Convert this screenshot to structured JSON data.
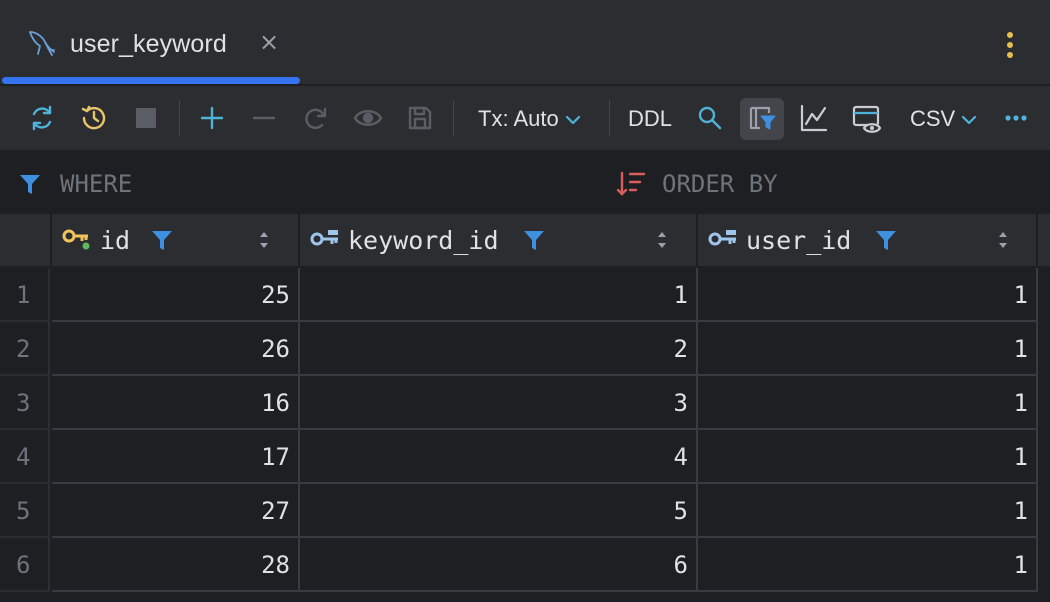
{
  "tab": {
    "label": "user_keyword",
    "close_glyph": "×",
    "icon": "mysql-dolphin-icon"
  },
  "toolbar": {
    "tx_mode": "Tx: Auto",
    "ddl": "DDL",
    "export_format": "CSV",
    "icons": [
      "reload-icon",
      "history-icon",
      "stop-icon",
      "add-row-icon",
      "delete-row-icon",
      "revert-icon",
      "view-icon",
      "submit-icon",
      "search-icon",
      "filter-toggle-icon",
      "chart-icon",
      "value-view-icon",
      "more-icon"
    ]
  },
  "filter": {
    "where_label": "WHERE",
    "orderby_label": "ORDER BY"
  },
  "columns": [
    {
      "name": "id",
      "key": "primary"
    },
    {
      "name": "keyword_id",
      "key": "foreign"
    },
    {
      "name": "user_id",
      "key": "foreign"
    }
  ],
  "rows": [
    {
      "num": "1",
      "id": "25",
      "keyword_id": "1",
      "user_id": "1"
    },
    {
      "num": "2",
      "id": "26",
      "keyword_id": "2",
      "user_id": "1"
    },
    {
      "num": "3",
      "id": "16",
      "keyword_id": "3",
      "user_id": "1"
    },
    {
      "num": "4",
      "id": "17",
      "keyword_id": "4",
      "user_id": "1"
    },
    {
      "num": "5",
      "id": "27",
      "keyword_id": "5",
      "user_id": "1"
    },
    {
      "num": "6",
      "id": "28",
      "keyword_id": "6",
      "user_id": "1"
    }
  ],
  "colors": {
    "accent": "#3574f0",
    "filter_blue": "#3d8fe0",
    "key_yellow": "#f2c55c",
    "orderby_red": "#db5c5c",
    "icon_teal": "#4fb3d9"
  }
}
